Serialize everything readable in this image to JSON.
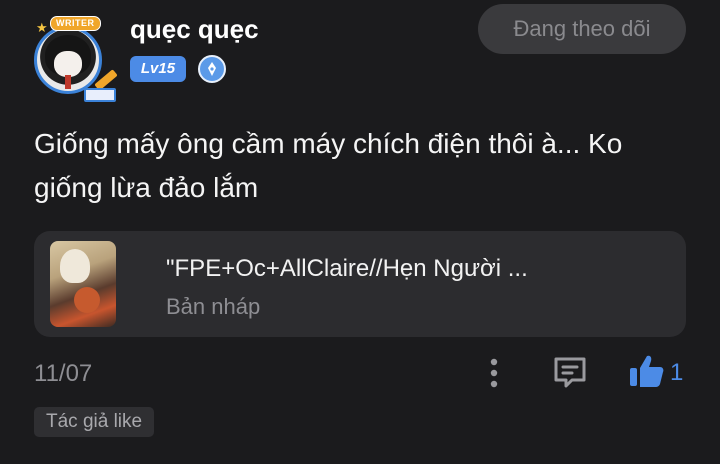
{
  "user": {
    "name": "quẹc quẹc",
    "level": "Lv15",
    "writer_badge": "WRITER"
  },
  "follow_button": {
    "label": "Đang theo dõi"
  },
  "comment": {
    "text": "Giống mấy ông cầm máy chích điện thôi à... Ko giống lừa đảo lắm"
  },
  "story": {
    "title": "\"FPE+Oc+AllClaire//Hẹn Người ...",
    "status": "Bản nháp"
  },
  "footer": {
    "date": "11/07",
    "like_count": "1",
    "author_like_label": "Tác giả like"
  },
  "colors": {
    "background": "#1b1b1d",
    "accent": "#4c8be6",
    "muted_text": "#8e8e93"
  },
  "icons": [
    "star-icon",
    "pen-icon",
    "author-badge-icon",
    "more-vertical-icon",
    "reply-comment-icon",
    "thumbs-up-icon"
  ]
}
